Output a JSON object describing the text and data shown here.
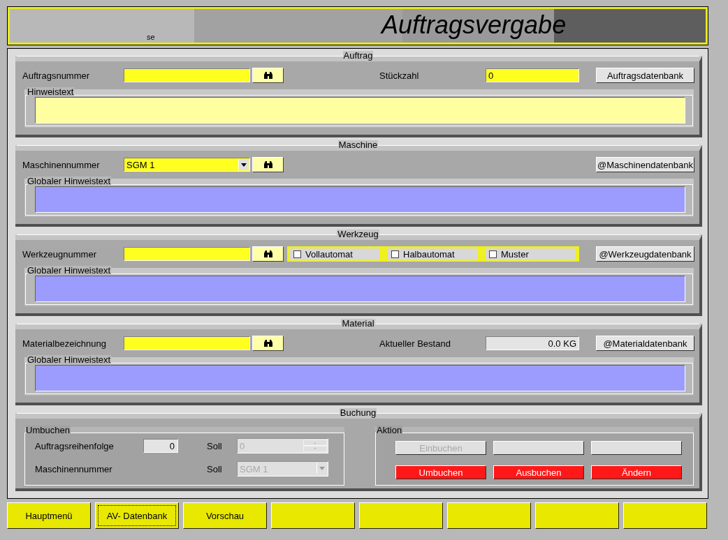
{
  "header": {
    "subtitle": "se",
    "title": "Auftragsvergabe"
  },
  "sections": [
    {
      "title": "Auftrag",
      "label": "Auftragsnummer",
      "input": {
        "kind": "text"
      },
      "extra": {
        "kind": "field",
        "label": "Stückzahl",
        "value": "0"
      },
      "db_button": "Auftragsdatenbank",
      "note": {
        "legend": "Hinweistext",
        "color": "#ffffa0"
      }
    },
    {
      "title": "Maschine",
      "label": "Maschinennummer",
      "input": {
        "kind": "combo",
        "value": "SGM 1"
      },
      "db_button": "@Maschinendatenbank",
      "note": {
        "legend": "Globaler Hinweistext",
        "color": "#9c9cff"
      }
    },
    {
      "title": "Werkzeug",
      "label": "Werkzeugnummer",
      "input": {
        "kind": "text"
      },
      "extra": {
        "kind": "checkboxes",
        "options": [
          {
            "label": "Vollautomat",
            "checked": false
          },
          {
            "label": "Halbautomat",
            "checked": false
          },
          {
            "label": "Muster",
            "checked": false
          }
        ]
      },
      "db_button": "@Werkzeugdatenbank",
      "note": {
        "legend": "Globaler Hinweistext",
        "color": "#9c9cff"
      }
    },
    {
      "title": "Material",
      "label": "Materialbezeichnung",
      "input": {
        "kind": "text"
      },
      "extra": {
        "kind": "readout",
        "label": "Aktueller Bestand",
        "value": "0.0 KG"
      },
      "db_button": "@Materialdatenbank",
      "note": {
        "legend": "Globaler Hinweistext",
        "color": "#9c9cff"
      }
    }
  ],
  "booking": {
    "title": "Buchung",
    "umbuchen": {
      "legend": "Umbuchen",
      "rows": [
        {
          "label": "Auftragsreihenfolge",
          "value": "0",
          "soll_label": "Soll",
          "soll": {
            "kind": "spin",
            "value": "0",
            "disabled": true
          }
        },
        {
          "label": "Maschinennummer",
          "soll_label": "Soll",
          "soll": {
            "kind": "combo",
            "value": "SGM 1",
            "disabled": true
          }
        }
      ]
    },
    "aktion": {
      "legend": "Aktion",
      "buttons": [
        {
          "kind": "disabled",
          "label": "Einbuchen"
        },
        {
          "kind": "plain"
        },
        {
          "kind": "plain"
        },
        {
          "kind": "danger",
          "label": "Umbuchen"
        },
        {
          "kind": "danger",
          "label": "Ausbuchen"
        },
        {
          "kind": "danger",
          "label": "Ändern"
        }
      ]
    }
  },
  "footer": [
    {
      "label": "Hauptmenü",
      "focused": false
    },
    {
      "label": "AV- Datenbank",
      "focused": true
    },
    {
      "label": "Vorschau",
      "focused": false
    },
    {
      "focused": false
    },
    {
      "focused": false
    },
    {
      "focused": false
    },
    {
      "focused": false
    },
    {
      "focused": false
    }
  ]
}
